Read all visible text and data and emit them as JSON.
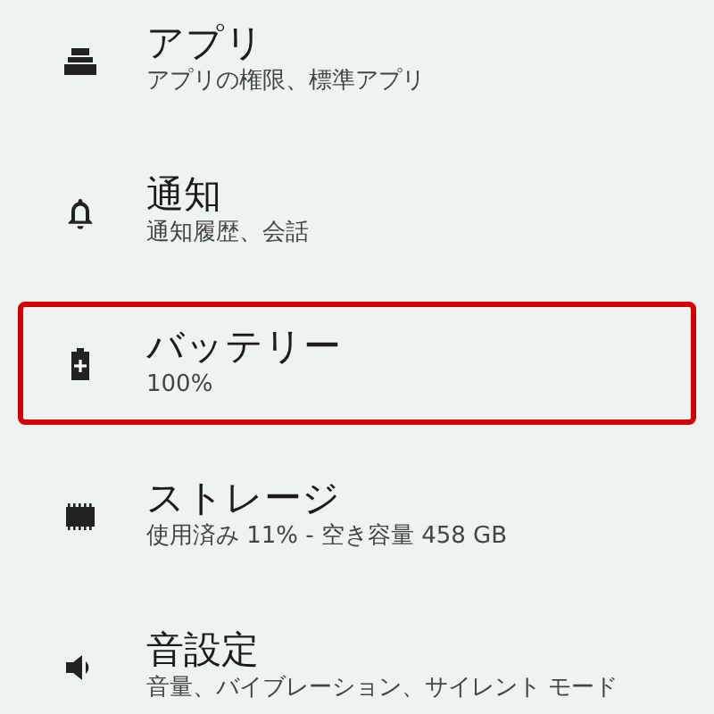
{
  "items": [
    {
      "kind": "apps",
      "title": "アプリ",
      "subtitle": "アプリの権限、標準アプリ",
      "highlighted": false
    },
    {
      "kind": "notifications",
      "title": "通知",
      "subtitle": "通知履歴、会話",
      "highlighted": false
    },
    {
      "kind": "battery",
      "title": "バッテリー",
      "subtitle": "100%",
      "highlighted": true
    },
    {
      "kind": "storage",
      "title": "ストレージ",
      "subtitle": "使用済み 11% - 空き容量 458 GB",
      "highlighted": false
    },
    {
      "kind": "sound",
      "title": "音設定",
      "subtitle": "音量、バイブレーション、サイレント モード",
      "highlighted": false
    }
  ]
}
